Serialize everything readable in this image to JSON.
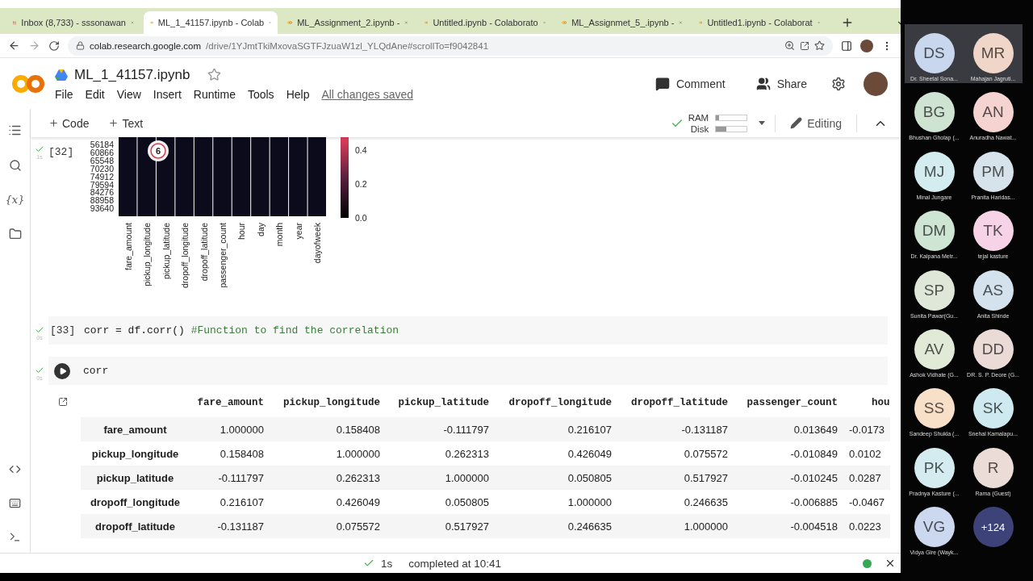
{
  "browser": {
    "tabs": [
      {
        "title": "Inbox (8,733) - sssonawan",
        "kind": "mail",
        "selected": false
      },
      {
        "title": "ML_1_41157.ipynb - Colab",
        "kind": "colab",
        "selected": true
      },
      {
        "title": "ML_Assignment_2.ipynb -",
        "kind": "colab",
        "selected": false
      },
      {
        "title": "Untitled.ipynb - Colaborato",
        "kind": "colab",
        "selected": false
      },
      {
        "title": "ML_Assignmet_5_.ipynb -",
        "kind": "colab",
        "selected": false
      },
      {
        "title": "Untitled1.ipynb - Colaborat",
        "kind": "colab",
        "selected": false
      }
    ],
    "address": {
      "host": "colab.research.google.com",
      "path": "/drive/1YJmtTkiMxovaSGTFJzuaW1zl_YLQdAne#scrollTo=f9042841"
    }
  },
  "notebook": {
    "title": "ML_1_41157.ipynb",
    "menu": [
      "File",
      "Edit",
      "View",
      "Insert",
      "Runtime",
      "Tools",
      "Help"
    ],
    "save_status": "All changes saved",
    "actions": [
      {
        "label": "Comment",
        "kind": "comment"
      },
      {
        "label": "Share",
        "kind": "share"
      }
    ]
  },
  "toolbar": {
    "insert": [
      "Code",
      "Text"
    ],
    "meters": [
      {
        "label": "RAM",
        "level": 0.1
      },
      {
        "label": "Disk",
        "level": 0.35
      }
    ],
    "mode": "Editing"
  },
  "sidebar": {
    "variables_label": "{x}"
  },
  "cells": [
    {
      "kind": "heatmap",
      "count": "[32]",
      "time": "1s",
      "yticklabels": [
        "56184",
        "60866",
        "65548",
        "70230",
        "74912",
        "79594",
        "84276",
        "88958",
        "93640"
      ],
      "xticklabels": [
        "fare_amount",
        "pickup_longitude",
        "pickup_latitude",
        "dropoff_longitude",
        "dropoff_latitude",
        "passenger_count",
        "hour",
        "day",
        "month",
        "year",
        "dayofweek"
      ],
      "colorbar_ticks": [
        "0.4",
        "0.2",
        "0.0"
      ],
      "badge": "6"
    },
    {
      "kind": "code",
      "count": "[33]",
      "time": "0s",
      "code": "corr = df.corr() ",
      "comment": "#Function to find the correlation"
    },
    {
      "kind": "run",
      "time": "0s",
      "code": "corr"
    }
  ],
  "output_table": {
    "columns": [
      "fare_amount",
      "pickup_longitude",
      "pickup_latitude",
      "dropoff_longitude",
      "dropoff_latitude",
      "passenger_count",
      "hou"
    ],
    "rows": [
      {
        "label": "fare_amount",
        "cells": [
          "1.000000",
          "0.158408",
          "-0.111797",
          "0.216107",
          "-0.131187",
          "0.013649",
          "-0.0173"
        ]
      },
      {
        "label": "pickup_longitude",
        "cells": [
          "0.158408",
          "1.000000",
          "0.262313",
          "0.426049",
          "0.075572",
          "-0.010849",
          "0.0102"
        ]
      },
      {
        "label": "pickup_latitude",
        "cells": [
          "-0.111797",
          "0.262313",
          "1.000000",
          "0.050805",
          "0.517927",
          "-0.010245",
          "0.0287"
        ]
      },
      {
        "label": "dropoff_longitude",
        "cells": [
          "0.216107",
          "0.426049",
          "0.050805",
          "1.000000",
          "0.246635",
          "-0.006885",
          "-0.0467"
        ]
      },
      {
        "label": "dropoff_latitude",
        "cells": [
          "-0.131187",
          "0.075572",
          "0.517927",
          "0.246635",
          "1.000000",
          "-0.004518",
          "0.0223"
        ]
      }
    ]
  },
  "status_bar": {
    "duration": "1s",
    "message": "completed at 10:41"
  },
  "participants": [
    {
      "kind": "person",
      "initials": "DS",
      "name": "Dr. Sheetal Sona...",
      "color": "#c9d7ee",
      "speaking": true
    },
    {
      "kind": "person",
      "initials": "MR",
      "name": "Mahajan Jagruti...",
      "color": "#f0d6c8",
      "speaking": true
    },
    {
      "kind": "person",
      "initials": "BG",
      "name": "Bhushan Gholap (...",
      "color": "#cfe3d3",
      "speaking": false
    },
    {
      "kind": "person",
      "initials": "AN",
      "name": "Anuradha Nawat...",
      "color": "#f5d3d0",
      "speaking": false
    },
    {
      "kind": "person",
      "initials": "MJ",
      "name": "Minal Jungare",
      "color": "#d2ecf0",
      "speaking": false
    },
    {
      "kind": "person",
      "initials": "PM",
      "name": "Pranita Haridas...",
      "color": "#d6e3ea",
      "speaking": false
    },
    {
      "kind": "person",
      "initials": "DM",
      "name": "Dr. Kalpana Metr...",
      "color": "#cfe5d3",
      "speaking": false
    },
    {
      "kind": "person",
      "initials": "TK",
      "name": "tejal kasture",
      "color": "#f6d3e6",
      "speaking": false
    },
    {
      "kind": "person",
      "initials": "SP",
      "name": "Sunita  Pawar(Gu...",
      "color": "#dfe8d8",
      "speaking": false
    },
    {
      "kind": "person",
      "initials": "AS",
      "name": "Anita  Shinde",
      "color": "#d3e2ec",
      "speaking": false
    },
    {
      "kind": "person",
      "initials": "AV",
      "name": "Ashok Vidhate (G...",
      "color": "#e0ead6",
      "speaking": false
    },
    {
      "kind": "person",
      "initials": "DD",
      "name": "DR. S. P. Deore (G...",
      "color": "#eadbd6",
      "speaking": false
    },
    {
      "kind": "person",
      "initials": "SS",
      "name": "Sandeep Shukla (...",
      "color": "#f7dfc8",
      "speaking": false
    },
    {
      "kind": "person",
      "initials": "SK",
      "name": "Snehal Kamalapu...",
      "color": "#cfe9f0",
      "speaking": false
    },
    {
      "kind": "person",
      "initials": "PK",
      "name": "Pradnya Kasture (...",
      "color": "#d4ecf0",
      "speaking": false
    },
    {
      "kind": "person",
      "initials": "R",
      "name": "Rama (Guest)",
      "color": "#ecdcd8",
      "speaking": false
    },
    {
      "kind": "person",
      "initials": "VG",
      "name": "Vidya Gire (Wayk...",
      "color": "#cbd8ef",
      "speaking": false
    },
    {
      "kind": "more",
      "initials": "+124",
      "color": "#3d4278",
      "speaking": false
    }
  ]
}
